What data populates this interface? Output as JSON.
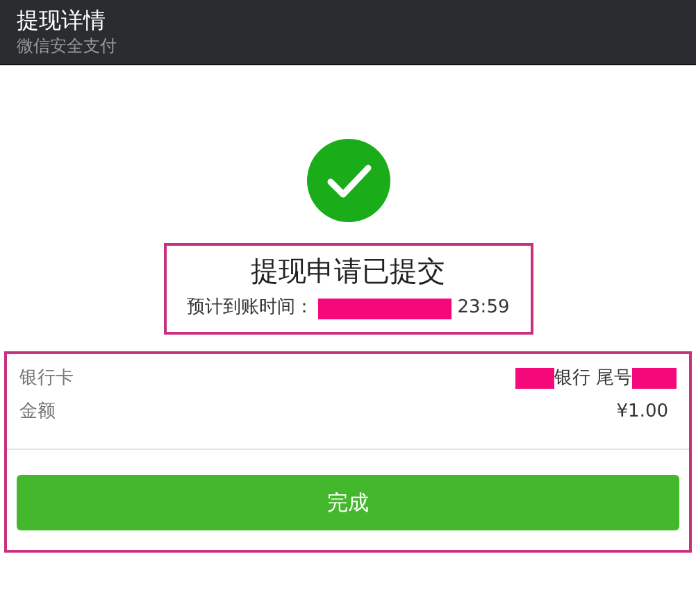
{
  "header": {
    "title": "提现详情",
    "subtitle": "微信安全支付"
  },
  "status": {
    "title": "提现申请已提交",
    "eta_label": "预计到账时间：",
    "eta_time": "23:59"
  },
  "details": [
    {
      "label": "银行卡",
      "value_bank": "银行",
      "value_tail": "尾号"
    },
    {
      "label": "金额",
      "value": "¥1.00"
    }
  ],
  "button": {
    "label": "完成"
  }
}
